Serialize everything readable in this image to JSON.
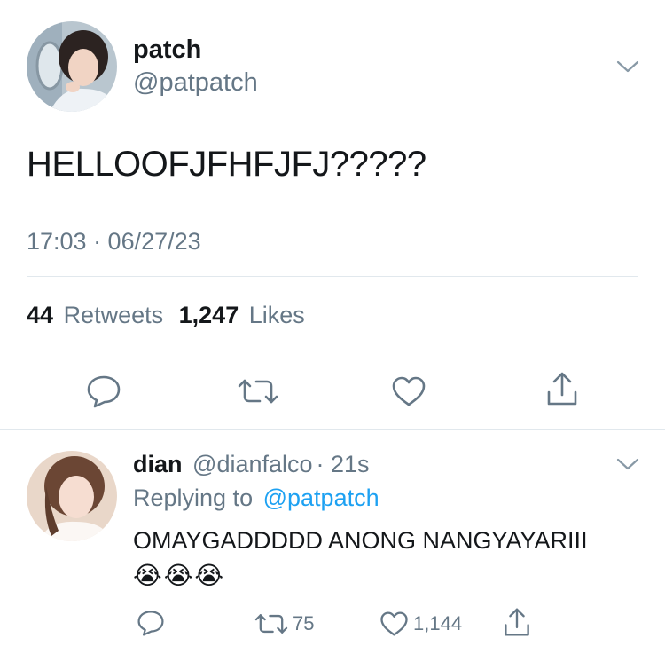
{
  "tweet": {
    "author_name": "patch",
    "author_handle": "@patpatch",
    "text": "HELLOOFJFHFJFJ?????",
    "timestamp": "17:03 · 06/27/23",
    "stats": {
      "retweets_count": "44",
      "retweets_label": "Retweets",
      "likes_count": "1,247",
      "likes_label": "Likes"
    }
  },
  "reply": {
    "author_name": "dian",
    "author_handle": "@dianfalco",
    "time": "· 21s",
    "replying_to_label": "Replying to",
    "replying_to_handle": "@patpatch",
    "text": "OMAYGADDDDD ANONG NANGYAYARIII",
    "emojis": "😭😭😭",
    "retweet_count": "75",
    "like_count": "1,144"
  },
  "icons": {
    "options": "chevron-down-icon",
    "reply": "reply-icon",
    "retweet": "retweet-icon",
    "like": "heart-icon",
    "share": "share-icon"
  },
  "colors": {
    "text": "#14171a",
    "muted": "#657786",
    "link": "#1da1f2",
    "divider": "#e1e8ed"
  }
}
